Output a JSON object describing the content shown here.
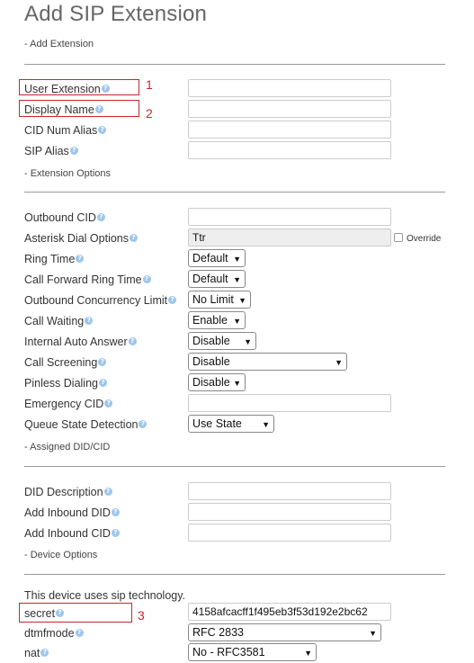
{
  "page": {
    "title": "Add SIP Extension"
  },
  "sections": {
    "add_extension": "- Add Extension",
    "extension_options": "- Extension Options",
    "assigned_did": "- Assigned DID/CID",
    "device_options": "- Device Options"
  },
  "fields": {
    "user_extension": {
      "label": "User Extension",
      "value": ""
    },
    "display_name": {
      "label": "Display Name",
      "value": ""
    },
    "cid_num_alias": {
      "label": "CID Num Alias",
      "value": ""
    },
    "sip_alias": {
      "label": "SIP Alias",
      "value": ""
    },
    "outbound_cid": {
      "label": "Outbound CID",
      "value": ""
    },
    "asterisk_dial_options": {
      "label": "Asterisk Dial Options",
      "value": "Ttr",
      "override_label": "Override"
    },
    "ring_time": {
      "label": "Ring Time",
      "value": "Default"
    },
    "call_forward_ring_time": {
      "label": "Call Forward Ring Time",
      "value": "Default"
    },
    "outbound_concurrency_limit": {
      "label": "Outbound Concurrency Limit",
      "value": "No Limit"
    },
    "call_waiting": {
      "label": "Call Waiting",
      "value": "Enable"
    },
    "internal_auto_answer": {
      "label": "Internal Auto Answer",
      "value": "Disable"
    },
    "call_screening": {
      "label": "Call Screening",
      "value": "Disable"
    },
    "pinless_dialing": {
      "label": "Pinless Dialing",
      "value": "Disable"
    },
    "emergency_cid": {
      "label": "Emergency CID",
      "value": ""
    },
    "queue_state_detection": {
      "label": "Queue State Detection",
      "value": "Use State"
    },
    "did_description": {
      "label": "DID Description",
      "value": ""
    },
    "add_inbound_did": {
      "label": "Add Inbound DID",
      "value": ""
    },
    "add_inbound_cid": {
      "label": "Add Inbound CID",
      "value": ""
    },
    "device_note": "This device uses sip technology.",
    "secret": {
      "label": "secret",
      "value": "4158afcacff1f495eb3f53d192e2bc62"
    },
    "dtmfmode": {
      "label": "dtmfmode",
      "value": "RFC 2833"
    },
    "nat": {
      "label": "nat",
      "value": "No - RFC3581"
    }
  },
  "annotations": {
    "n1": "1",
    "n2": "2",
    "n3": "3"
  },
  "icons": {
    "help": "?",
    "dropdown_arrow": "▼"
  }
}
